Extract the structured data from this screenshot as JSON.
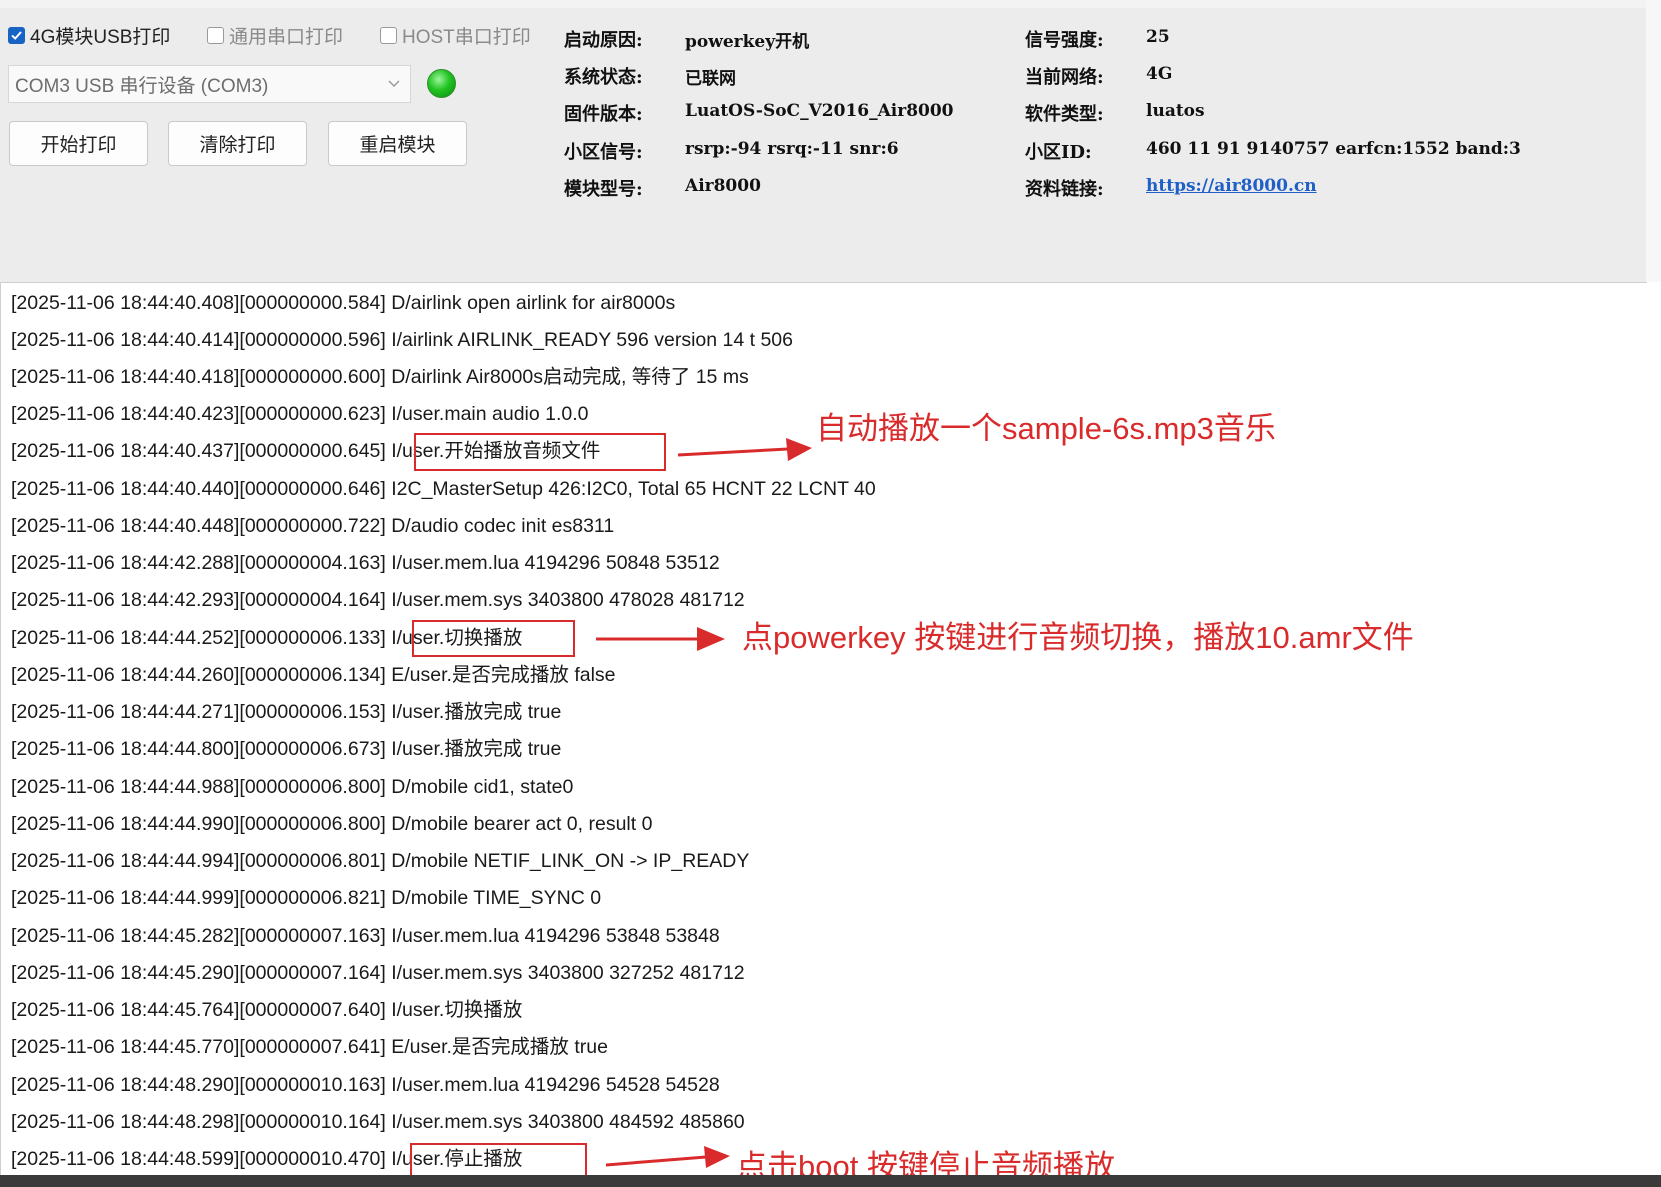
{
  "toolbar": {
    "checkboxes": [
      {
        "label": "4G模块USB打印",
        "checked": true
      },
      {
        "label": "通用串口打印",
        "checked": false
      },
      {
        "label": "HOST串口打印",
        "checked": false
      }
    ],
    "port_select": "COM3 USB 串行设备 (COM3)",
    "status_led_color": "#22c422",
    "buttons": [
      "开始打印",
      "清除打印",
      "重启模块"
    ]
  },
  "device_info": {
    "left": [
      {
        "label": "启动原因:",
        "value": "powerkey开机"
      },
      {
        "label": "系统状态:",
        "value": "已联网"
      },
      {
        "label": "固件版本:",
        "value": "LuatOS-SoC_V2016_Air8000"
      },
      {
        "label": "小区信号:",
        "value": "rsrp:-94 rsrq:-11 snr:6"
      },
      {
        "label": "模块型号:",
        "value": "Air8000"
      }
    ],
    "right": [
      {
        "label": "信号强度:",
        "value": "25"
      },
      {
        "label": "当前网络:",
        "value": "4G"
      },
      {
        "label": "软件类型:",
        "value": "luatos"
      },
      {
        "label": "小区ID:",
        "value": "460 11 91 9140757 earfcn:1552 band:3"
      },
      {
        "label": "资料链接:",
        "value": "https://air8000.cn"
      }
    ]
  },
  "log": [
    "[2025-11-06 18:44:40.408][000000000.584] D/airlink open airlink for air8000s",
    "[2025-11-06 18:44:40.414][000000000.596] I/airlink AIRLINK_READY 596 version 14 t 506",
    "[2025-11-06 18:44:40.418][000000000.600] D/airlink Air8000s启动完成, 等待了 15 ms",
    "[2025-11-06 18:44:40.423][000000000.623] I/user.main audio 1.0.0",
    "[2025-11-06 18:44:40.437][000000000.645] I/user.开始播放音频文件",
    "[2025-11-06 18:44:40.440][000000000.646] I2C_MasterSetup 426:I2C0, Total 65 HCNT 22 LCNT 40",
    "[2025-11-06 18:44:40.448][000000000.722] D/audio codec init es8311",
    "[2025-11-06 18:44:42.288][000000004.163] I/user.mem.lua 4194296 50848 53512",
    "[2025-11-06 18:44:42.293][000000004.164] I/user.mem.sys 3403800 478028 481712",
    "[2025-11-06 18:44:44.252][000000006.133] I/user.切换播放",
    "[2025-11-06 18:44:44.260][000000006.134] E/user.是否完成播放 false",
    "[2025-11-06 18:44:44.271][000000006.153] I/user.播放完成 true",
    "[2025-11-06 18:44:44.800][000000006.673] I/user.播放完成 true",
    "[2025-11-06 18:44:44.988][000000006.800] D/mobile cid1, state0",
    "[2025-11-06 18:44:44.990][000000006.800] D/mobile bearer act 0, result 0",
    "[2025-11-06 18:44:44.994][000000006.801] D/mobile NETIF_LINK_ON -> IP_READY",
    "[2025-11-06 18:44:44.999][000000006.821] D/mobile TIME_SYNC 0",
    "[2025-11-06 18:44:45.282][000000007.163] I/user.mem.lua 4194296 53848 53848",
    "[2025-11-06 18:44:45.290][000000007.164] I/user.mem.sys 3403800 327252 481712",
    "[2025-11-06 18:44:45.764][000000007.640] I/user.切换播放",
    "[2025-11-06 18:44:45.770][000000007.641] E/user.是否完成播放 true",
    "[2025-11-06 18:44:48.290][000000010.163] I/user.mem.lua 4194296 54528 54528",
    "[2025-11-06 18:44:48.298][000000010.164] I/user.mem.sys 3403800 484592 485860",
    "[2025-11-06 18:44:48.599][000000010.470] I/user.停止播放"
  ],
  "annotations": [
    "自动播放一个sample-6s.mp3音乐",
    "点powerkey 按键进行音频切换，播放10.amr文件",
    "点击boot 按键停止音频播放"
  ],
  "annotation_color": "#d92b2b"
}
